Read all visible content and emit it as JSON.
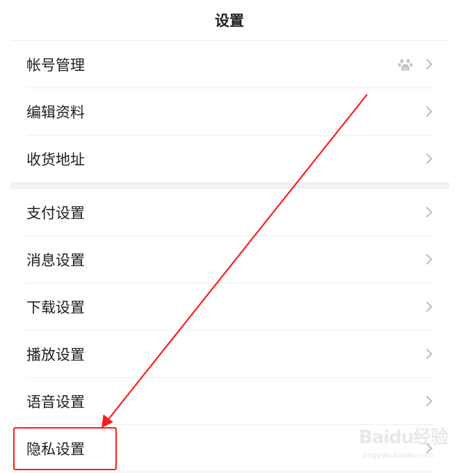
{
  "header": {
    "title": "设置"
  },
  "groups": [
    {
      "items": [
        {
          "label": "帐号管理",
          "icon": "baidu-paw-icon"
        },
        {
          "label": "编辑资料"
        },
        {
          "label": "收货地址"
        }
      ]
    },
    {
      "items": [
        {
          "label": "支付设置"
        },
        {
          "label": "消息设置"
        },
        {
          "label": "下载设置"
        },
        {
          "label": "播放设置"
        },
        {
          "label": "语音设置"
        },
        {
          "label": "隐私设置"
        }
      ]
    }
  ],
  "annotation": {
    "color": "#ff1a1a",
    "target": "隐私设置"
  },
  "watermark": {
    "brand": "Baidu经验",
    "url": "jingyan.baidu.com"
  },
  "colors": {
    "text": "#1f1f1f",
    "divider": "#ededed",
    "chevron": "#b5b5b5",
    "section_gap": "#f2f2f2"
  }
}
